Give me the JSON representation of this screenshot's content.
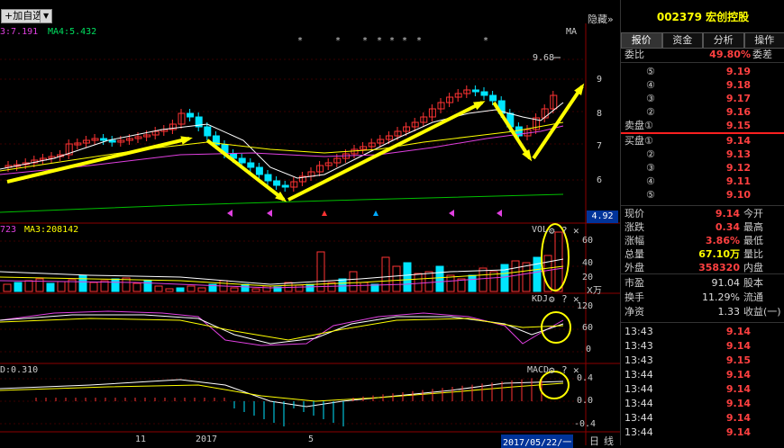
{
  "toolbar": {
    "add_label": "+加自选",
    "dropdown_label": "▼"
  },
  "main_panel": {
    "ma_legend_1": "3:7.191",
    "ma_legend_2": "MA4:5.432",
    "ma_label": "MA",
    "hide_label": "隐藏",
    "hide_arrow": "»",
    "price_high_label": "9.68",
    "axis_ticks": [
      "9",
      "8",
      "7",
      "6"
    ],
    "current_price_tag": "4.92",
    "stars": [
      "*",
      "*",
      "*",
      "*",
      "*",
      "*",
      "*",
      "*"
    ]
  },
  "vol_panel": {
    "legend_1": "723",
    "legend_2": "MA3:208142",
    "title": "VOL",
    "ticks": [
      "60",
      "40",
      "20"
    ],
    "unit": "X万"
  },
  "kdj_panel": {
    "title": "KDJ",
    "ticks": [
      "120",
      "60",
      "0"
    ]
  },
  "macd_panel": {
    "legend": "D:0.310",
    "title": "MACD",
    "ticks": [
      "0.4",
      "0.0",
      "-0.4"
    ]
  },
  "x_axis": {
    "labels": [
      "11",
      "2017",
      "5"
    ],
    "date_highlight": "2017/05/22/一",
    "day_label": "日",
    "line_label": "线"
  },
  "right_panel": {
    "code": "002379",
    "name": "宏创控股",
    "tabs": [
      "报价",
      "资金",
      "分析",
      "操作"
    ],
    "weibi_label": "委比",
    "weibi_value": "49.80%",
    "weicha_label": "委差",
    "sell_rows": [
      {
        "label": "⑤",
        "price": "9.19"
      },
      {
        "label": "④",
        "price": "9.18"
      },
      {
        "label": "③",
        "price": "9.17"
      },
      {
        "label": "②",
        "price": "9.16"
      },
      {
        "label": "卖盘①",
        "price": "9.15"
      }
    ],
    "buy_rows": [
      {
        "label": "买盘①",
        "price": "9.14"
      },
      {
        "label": "②",
        "price": "9.13"
      },
      {
        "label": "③",
        "price": "9.12"
      },
      {
        "label": "④",
        "price": "9.11"
      },
      {
        "label": "⑤",
        "price": "9.10"
      }
    ],
    "stats": [
      {
        "label": "现价",
        "value": "9.14",
        "label2": "今开"
      },
      {
        "label": "涨跌",
        "value": "0.34",
        "label2": "最高"
      },
      {
        "label": "涨幅",
        "value": "3.86%",
        "label2": "最低"
      },
      {
        "label": "总量",
        "value": "67.10万",
        "label2": "量比"
      },
      {
        "label": "外盘",
        "value": "358320",
        "label2": "内盘"
      }
    ],
    "stats2": [
      {
        "label": "市盈",
        "value": "91.04",
        "label2": "股本"
      },
      {
        "label": "换手",
        "value": "11.29%",
        "label2": "流通"
      },
      {
        "label": "净资",
        "value": "1.33",
        "label2": "收益(一)"
      }
    ],
    "ticks": [
      {
        "time": "13:43",
        "price": "9.14"
      },
      {
        "time": "13:43",
        "price": "9.14"
      },
      {
        "time": "13:43",
        "price": "9.15"
      },
      {
        "time": "13:44",
        "price": "9.14"
      },
      {
        "time": "13:44",
        "price": "9.14"
      },
      {
        "time": "13:44",
        "price": "9.14"
      },
      {
        "time": "13:44",
        "price": "9.14"
      },
      {
        "time": "13:44",
        "price": "9.14"
      }
    ]
  },
  "colors": {
    "up": "#ff3333",
    "down": "#00e5ff",
    "ma_white": "#ffffff",
    "ma_yellow": "#ffff00",
    "ma_magenta": "#e040e0",
    "ma_green": "#00c000",
    "annotation": "#ffff00"
  }
}
